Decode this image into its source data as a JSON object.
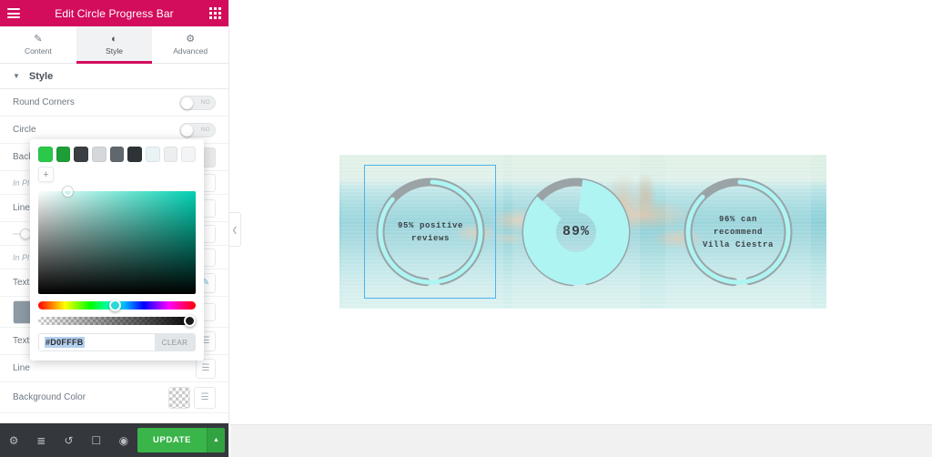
{
  "panel": {
    "header": {
      "title": "Edit Circle Progress Bar",
      "menu_icon": "hamburger-icon",
      "grid_icon": "grid-icon",
      "bg_color": "#d30c5c"
    },
    "tabs": [
      {
        "label": "Content",
        "icon": "pencil-icon",
        "glyph": "✎",
        "active": false
      },
      {
        "label": "Style",
        "icon": "half-circle-icon",
        "glyph": "◐",
        "active": true
      },
      {
        "label": "Advanced",
        "icon": "gear-icon",
        "glyph": "⚙",
        "active": false
      }
    ],
    "section": {
      "title": "Style",
      "caret": "▼"
    },
    "controls": [
      {
        "name": "round-corners",
        "label": "Round Corners",
        "type": "switch",
        "value": "NO"
      },
      {
        "name": "circle-truncated",
        "label": "Circle",
        "type": "switch",
        "value": "NO"
      },
      {
        "name": "background-truncated",
        "label": "Back",
        "type": "swatch"
      },
      {
        "name": "inner-placeholder-1",
        "label": "In Pl",
        "type": "hint"
      },
      {
        "name": "line-width-truncated",
        "label": "Line",
        "type": "slider"
      },
      {
        "name": "inner-placeholder-2",
        "label": "In Pl",
        "type": "hint"
      },
      {
        "name": "text-color-truncated",
        "label": "Text",
        "type": "swatch-pen"
      },
      {
        "name": "text-secondary-truncated",
        "label": "Text",
        "type": "swatch-stack"
      },
      {
        "name": "line-secondary-truncated",
        "label": "Line",
        "type": "swatch-stack"
      },
      {
        "name": "background-color",
        "label": "Background Color",
        "type": "checker-stack"
      }
    ],
    "picker": {
      "swatches": [
        "#2bc84a",
        "#1e9e36",
        "#3a3f43",
        "#d5d8da",
        "#60686e",
        "#2d3236",
        "#e9f2f4",
        "#eceeef",
        "#f3f4f5"
      ],
      "add_label": "+",
      "hex": "#D0FFFB",
      "clear_label": "CLEAR",
      "selected_color": "#00d1b2"
    }
  },
  "bottombar": {
    "icons": [
      {
        "name": "settings-icon",
        "glyph": "⚙"
      },
      {
        "name": "navigator-layers-icon",
        "glyph": "≣"
      },
      {
        "name": "history-icon",
        "glyph": "↺"
      },
      {
        "name": "responsive-mode-icon",
        "glyph": "☐"
      },
      {
        "name": "preview-eye-icon",
        "glyph": "◉"
      }
    ],
    "update_label": "UPDATE",
    "update_caret": "▲",
    "update_color": "#39b54a"
  },
  "canvas": {
    "collapse_icon": "❮",
    "widgets": [
      {
        "name": "circle-progress-left",
        "percent": 95,
        "text": "95% positive\nreviews",
        "text_lines": [
          "95% positive",
          "reviews"
        ],
        "selected": true,
        "track_color": "#9aa3a6",
        "fill_color": "#aef4f2"
      },
      {
        "name": "circle-progress-center",
        "percent": 89,
        "text": "89%",
        "text_lines": [
          "89%"
        ],
        "selected": false,
        "track_color": "#9aa3a6",
        "fill_color": "#aef4f2"
      },
      {
        "name": "circle-progress-right",
        "percent": 96,
        "text": "96% can\nrecommend\nVilla Ciestra",
        "text_lines": [
          "96% can",
          "recommend",
          "Villa Ciestra"
        ],
        "selected": false,
        "track_color": "#9aa3a6",
        "fill_color": "#aef4f2"
      }
    ]
  }
}
